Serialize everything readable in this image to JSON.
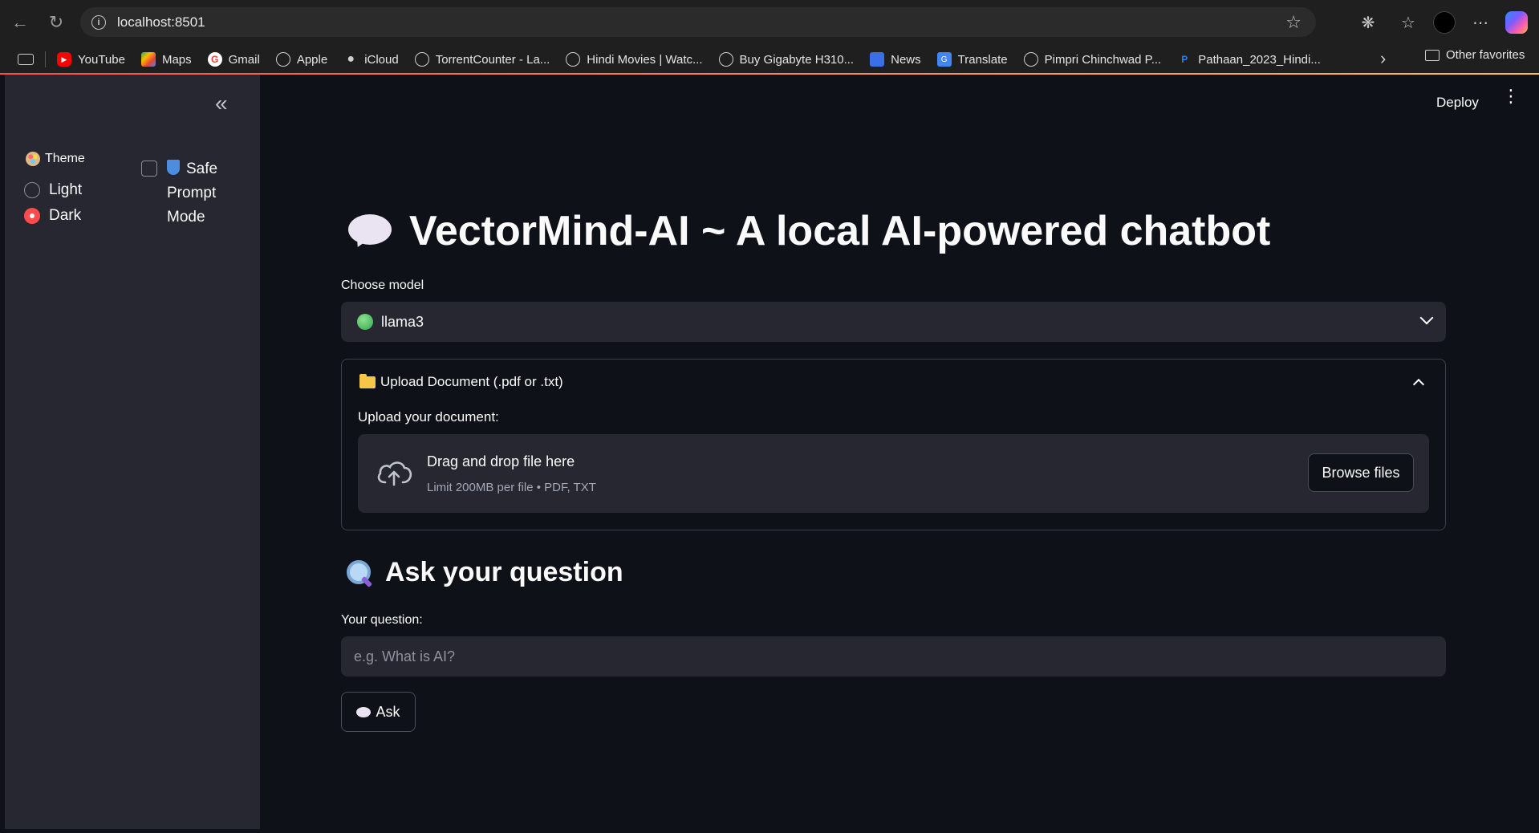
{
  "browser": {
    "url": "localhost:8501",
    "bookmarks": [
      {
        "label": "YouTube",
        "icon": "youtube-icon"
      },
      {
        "label": "Maps",
        "icon": "maps-icon"
      },
      {
        "label": "Gmail",
        "icon": "google-icon"
      },
      {
        "label": "Apple",
        "icon": "globe-icon"
      },
      {
        "label": "iCloud",
        "icon": "apple-icon"
      },
      {
        "label": "TorrentCounter - La...",
        "icon": "globe-icon"
      },
      {
        "label": "Hindi Movies | Watc...",
        "icon": "globe-icon"
      },
      {
        "label": "Buy Gigabyte H310...",
        "icon": "globe-icon"
      },
      {
        "label": "News",
        "icon": "news-icon"
      },
      {
        "label": "Translate",
        "icon": "translate-icon"
      },
      {
        "label": "Pimpri Chinchwad P...",
        "icon": "globe-icon"
      },
      {
        "label": "Pathaan_2023_Hindi...",
        "icon": "p-icon"
      }
    ],
    "other_favorites": "Other favorites"
  },
  "sidebar": {
    "theme_label": "Theme",
    "theme_options": [
      "Light",
      "Dark"
    ],
    "theme_selected": "Dark",
    "safe_mode_label_line1": "Safe",
    "safe_mode_label_line2": "Prompt",
    "safe_mode_label_line3": "Mode",
    "safe_mode_checked": false
  },
  "header": {
    "deploy_label": "Deploy"
  },
  "main": {
    "title": "VectorMind-AI ~ A local AI-powered chatbot",
    "model_label": "Choose model",
    "model_selected": "llama3",
    "upload_expander_title": "Upload Document (.pdf or .txt)",
    "upload_label": "Upload your document:",
    "dropzone_title": "Drag and drop file here",
    "dropzone_limit": "Limit 200MB per file • PDF, TXT",
    "browse_label": "Browse files",
    "question_heading": "Ask your question",
    "question_label": "Your question:",
    "question_placeholder": "e.g. What is AI?",
    "ask_label": "Ask"
  },
  "colors": {
    "background": "#0e1117",
    "sidebar": "#262730",
    "accent": "#ff4b4b"
  }
}
